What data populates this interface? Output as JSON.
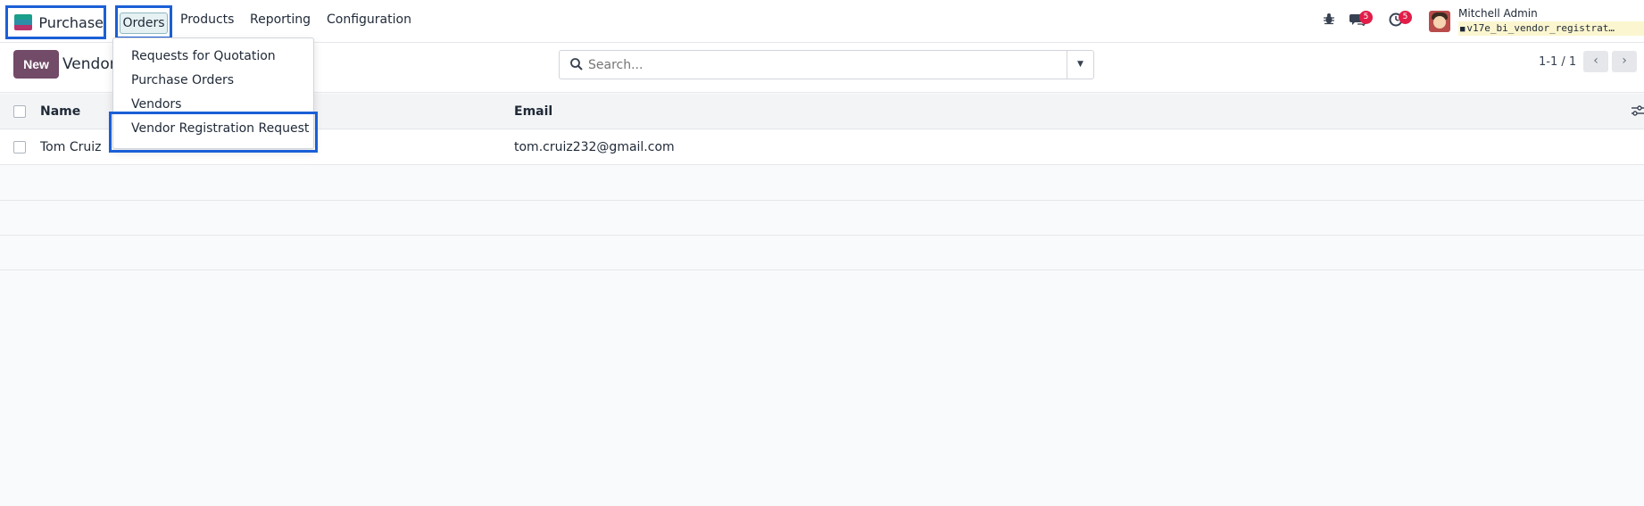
{
  "navbar": {
    "app_name": "Purchase",
    "app_logo_colors": [
      "#1a9f8c",
      "#2b8fa8",
      "#b7336c"
    ],
    "menu": {
      "orders": "Orders",
      "products": "Products",
      "reporting": "Reporting",
      "configuration": "Configuration"
    },
    "systray": {
      "debug_icon": "bug-icon",
      "messages_icon": "chat-icon",
      "messages_count": "5",
      "activities_icon": "clock-icon",
      "activities_count": "5"
    },
    "user": {
      "name": "Mitchell Admin",
      "database": "v17e_bi_vendor_registrat…"
    }
  },
  "control_panel": {
    "new_label": "New",
    "breadcrumb": "Vendor",
    "search_placeholder": "Search...",
    "pager_value": "1-1 / 1"
  },
  "orders_menu": {
    "items": [
      "Requests for Quotation",
      "Purchase Orders",
      "Vendors",
      "Vendor Registration Request"
    ],
    "highlighted_item": "Vendor Registration Request"
  },
  "table": {
    "columns": [
      "Name",
      "Email"
    ],
    "rows": [
      {
        "name": "Tom Cruiz",
        "email": "tom.cruiz232@gmail.com"
      }
    ]
  },
  "colors": {
    "primary": "#714b67",
    "highlight_box": "#1a5fd6",
    "badge": "#e11d48"
  }
}
